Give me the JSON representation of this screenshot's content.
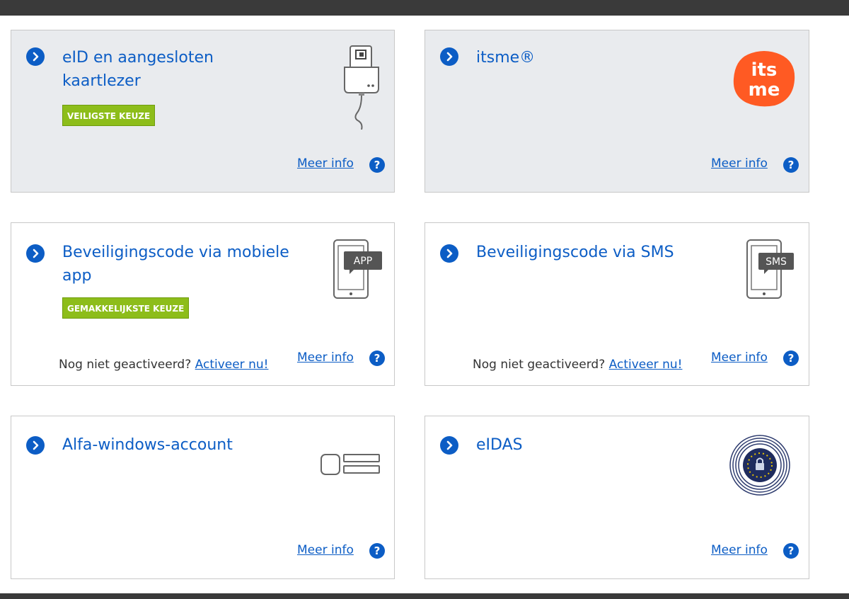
{
  "cards": [
    {
      "title_line1": "eID en aangesloten",
      "title_line2": "kaartlezer",
      "badge": "VEILIGSTE KEUZE",
      "meer_info": "Meer info",
      "icon": "card-reader-icon"
    },
    {
      "title_line1": "itsme®",
      "logo_text_top": "its",
      "logo_text_bottom": "me",
      "meer_info": "Meer info",
      "icon": "itsme-logo"
    },
    {
      "title_line1": "Beveiligingscode via mobiele",
      "title_line2": "app",
      "badge": "GEMAKKELIJKSTE KEUZE",
      "nog_text": "Nog niet geactiveerd?",
      "activeer": "Activeer nu!",
      "icon_label": "APP",
      "meer_info": "Meer info",
      "icon": "phone-app-icon"
    },
    {
      "title_line1": "Beveiligingscode via SMS",
      "nog_text": "Nog niet geactiveerd?",
      "activeer": "Activeer nu!",
      "icon_label": "SMS",
      "meer_info": "Meer info",
      "icon": "phone-sms-icon"
    },
    {
      "title_line1": "Alfa-windows-account",
      "meer_info": "Meer info",
      "icon": "account-icon"
    },
    {
      "title_line1": "eIDAS",
      "meer_info": "Meer info",
      "icon": "eidas-icon"
    }
  ],
  "help_symbol": "?",
  "colors": {
    "link": "#0c5dc5",
    "badge": "#8dbd1a",
    "itsme": "#ff5a23",
    "shaded": "#e9ebee",
    "bar": "#3a3a3a"
  }
}
